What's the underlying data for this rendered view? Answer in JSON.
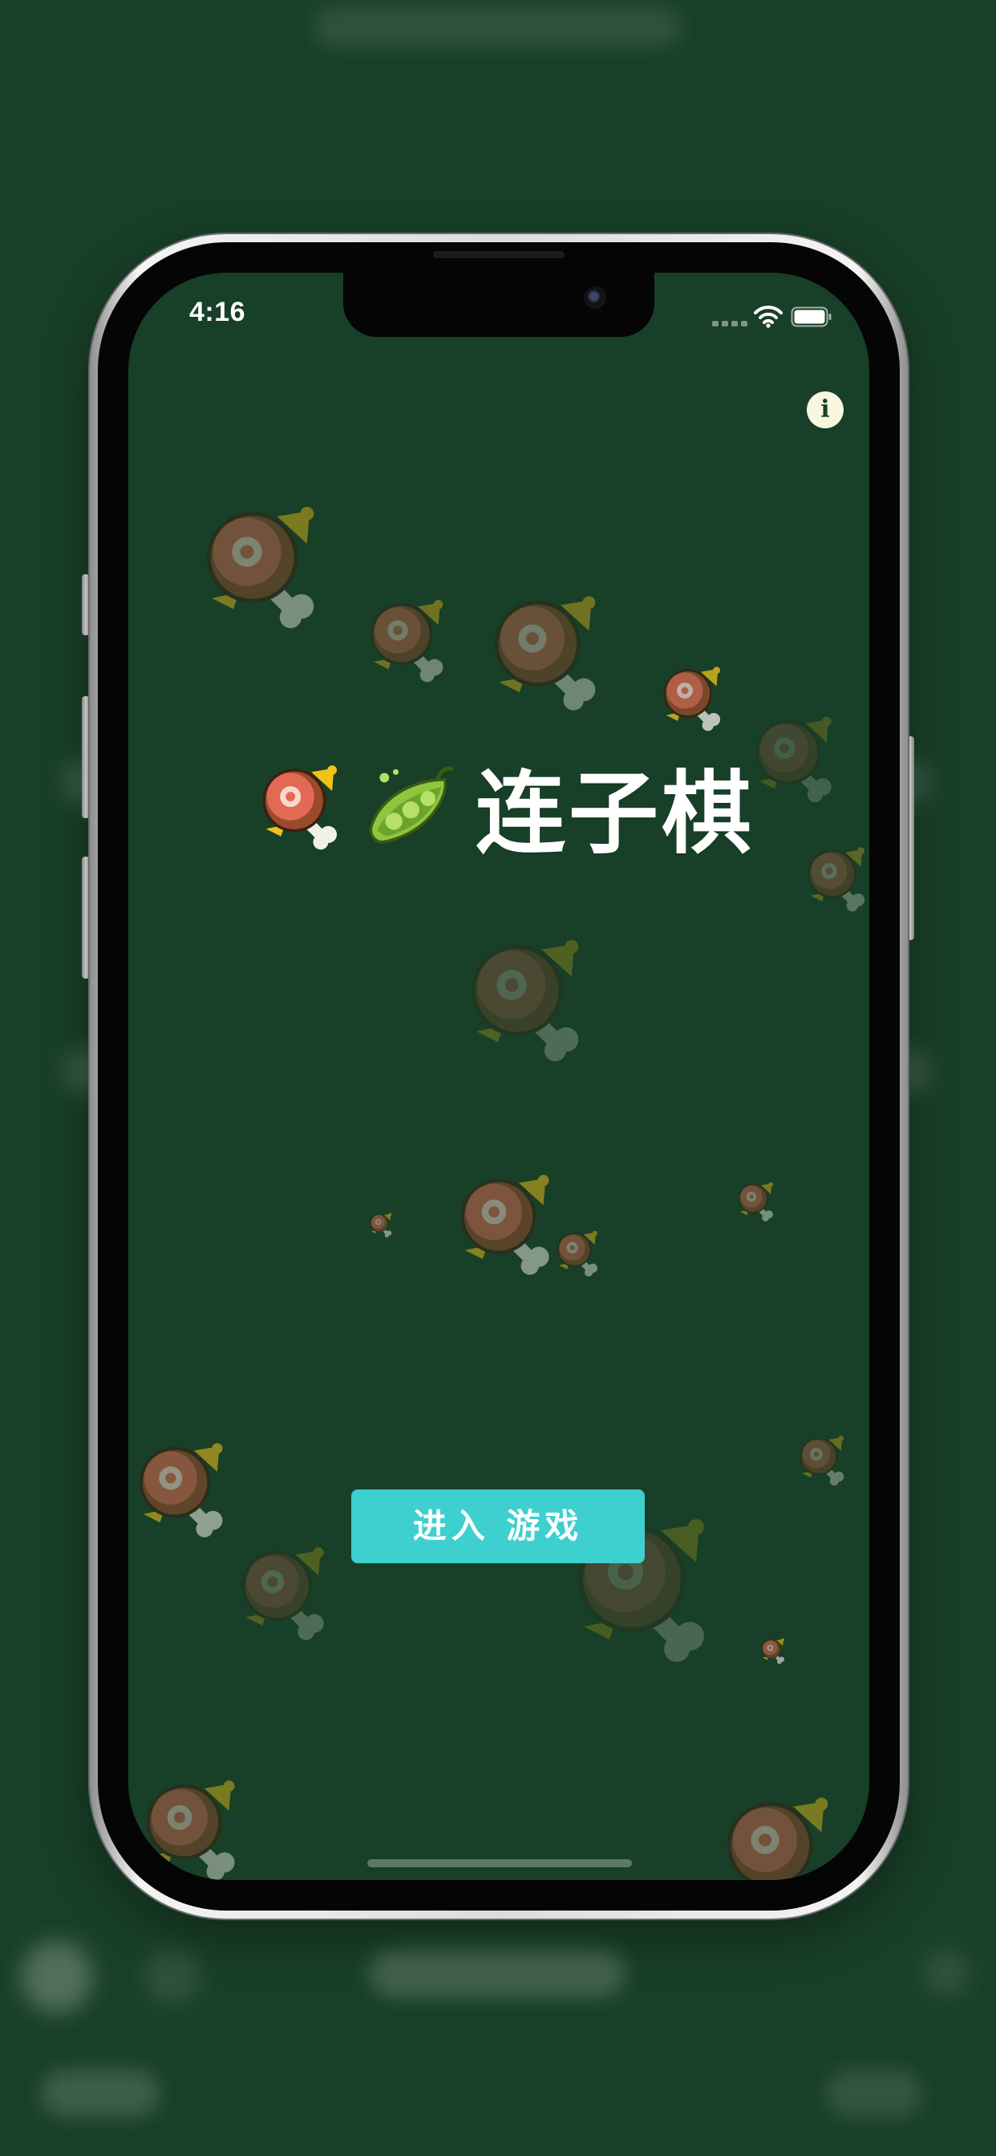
{
  "status_bar": {
    "time": "4:16",
    "wifi_icon": "wifi-icon",
    "battery_icon": "battery-full-icon"
  },
  "header": {
    "info_icon": "info-icon",
    "info_glyph": "i"
  },
  "title": {
    "text": "连子棋",
    "icons": [
      "meat-icon",
      "peapod-icon"
    ]
  },
  "actions": {
    "enter_game_label": "进入 游戏"
  },
  "colors": {
    "background": "#183f27",
    "button": "#3ecfcf",
    "button_text": "#ffffff",
    "info_button": "#f7f6df"
  },
  "decorations": {
    "falling_icon": "meat-icon"
  }
}
